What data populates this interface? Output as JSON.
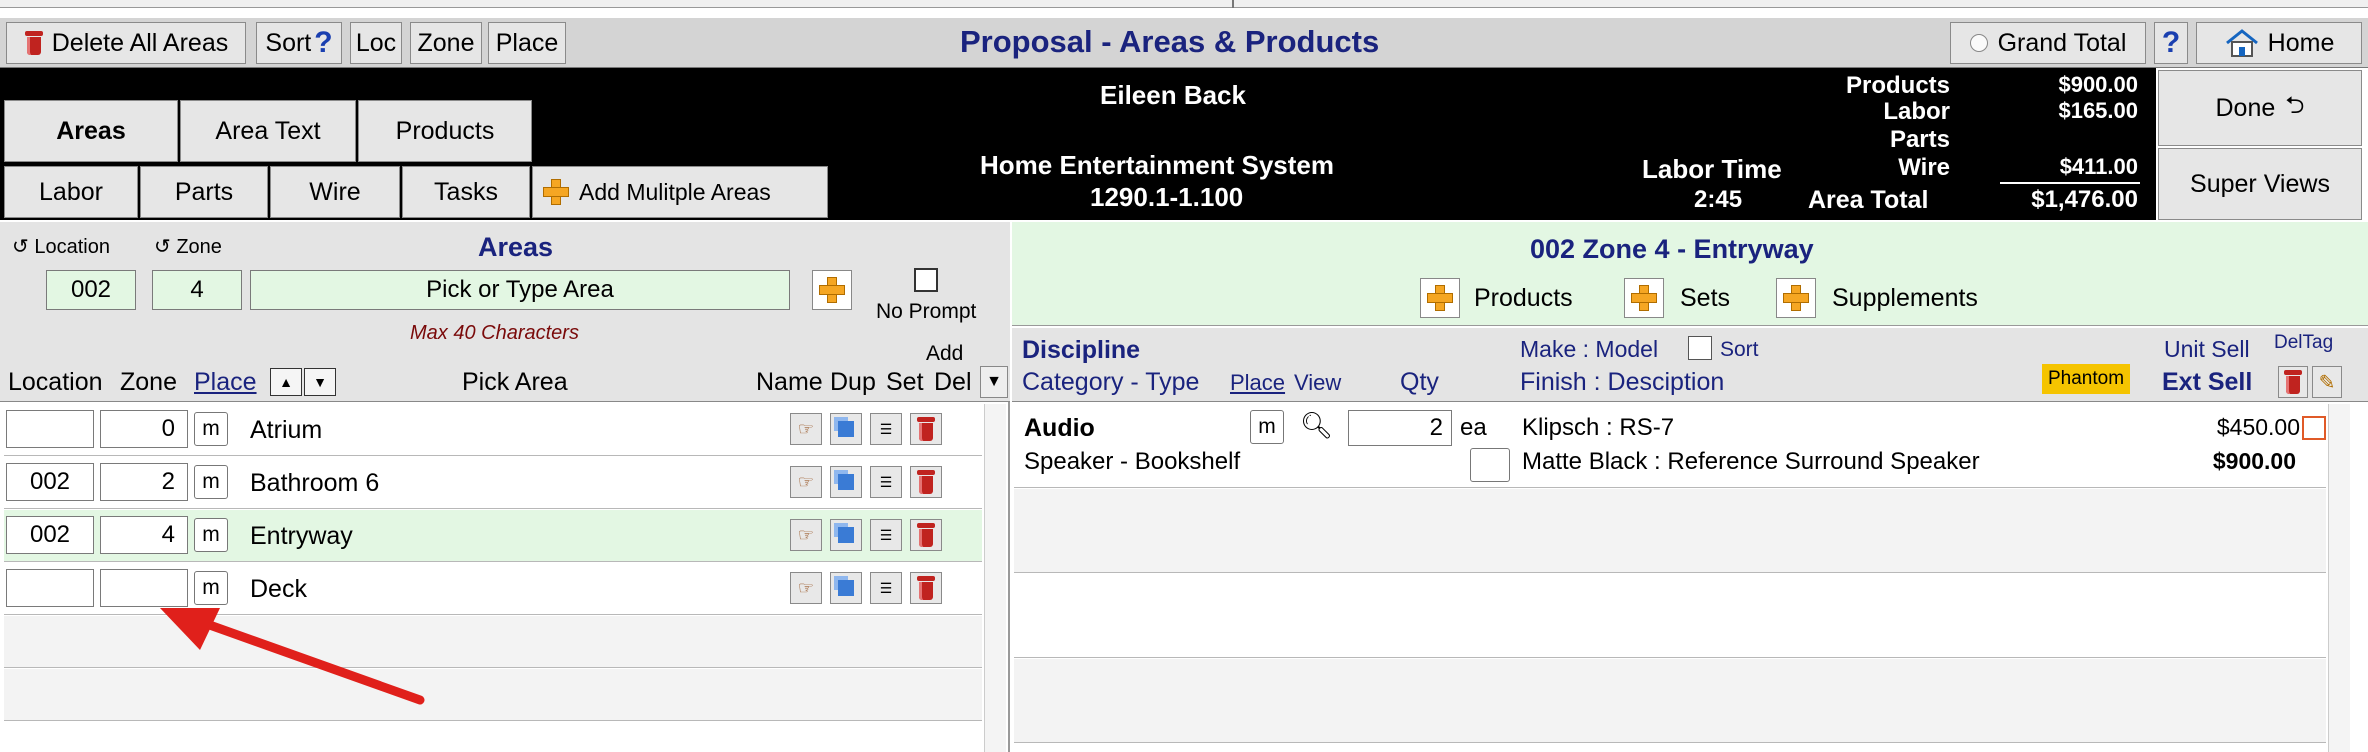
{
  "toolbar": {
    "delete_all": "Delete All Areas",
    "sort": "Sort",
    "sort_help": "?",
    "loc": "Loc",
    "zone": "Zone",
    "place": "Place",
    "title": "Proposal - Areas & Products",
    "grand_total": "Grand Total",
    "help": "?",
    "home": "Home"
  },
  "header": {
    "client": "Eileen Back",
    "project": "Home Entertainment System",
    "project_number": "1290.1-1.100",
    "labor_time_label": "Labor Time",
    "labor_time": "2:45",
    "area_total_label": "Area Total",
    "area_total": "$1,476.00",
    "totals": [
      {
        "label": "Products",
        "value": "$900.00"
      },
      {
        "label": "Labor",
        "value": "$165.00"
      },
      {
        "label": "Parts",
        "value": ""
      },
      {
        "label": "Wire",
        "value": "$411.00"
      }
    ],
    "done": "Done",
    "super_views": "Super Views"
  },
  "tabs": {
    "row1": [
      "Areas",
      "Area Text",
      "Products"
    ],
    "row2": [
      "Labor",
      "Parts",
      "Wire",
      "Tasks"
    ],
    "add_multiple": "Add Mulitple Areas"
  },
  "areas_panel": {
    "location_label": "Location",
    "zone_label": "Zone",
    "title": "Areas",
    "location_value": "002",
    "zone_value": "4",
    "area_placeholder": "Pick or Type Area",
    "no_prompt": "No Prompt",
    "max_chars": "Max 40 Characters",
    "col_location": "Location",
    "col_zone": "Zone",
    "col_place": "Place",
    "col_pick_area": "Pick Area",
    "col_name": "Name",
    "col_dup": "Dup",
    "col_add": "Add",
    "col_set": "Set",
    "col_del": "Del",
    "rows": [
      {
        "location": "",
        "zone": "0",
        "place": "m",
        "name": "Atrium"
      },
      {
        "location": "002",
        "zone": "2",
        "place": "m",
        "name": "Bathroom 6"
      },
      {
        "location": "002",
        "zone": "4",
        "place": "m",
        "name": "Entryway"
      },
      {
        "location": "",
        "zone": "",
        "place": "m",
        "name": "Deck"
      }
    ]
  },
  "products_panel": {
    "zone_title": "002 Zone 4 - Entryway",
    "add_products": "Products",
    "add_sets": "Sets",
    "add_supplements": "Supplements",
    "col_discipline": "Discipline",
    "col_category": "Category - Type",
    "col_place": "Place",
    "col_view": "View",
    "col_qty": "Qty",
    "col_make_model": "Make : Model",
    "col_sort": "Sort",
    "col_finish": "Finish : Desciption",
    "phantom": "Phantom",
    "col_unit_sell": "Unit Sell",
    "col_ext_sell": "Ext Sell",
    "col_del": "Del",
    "col_tag": "Tag",
    "items": [
      {
        "discipline": "Audio",
        "category": "Speaker - Bookshelf",
        "place": "m",
        "qty": "2",
        "unit": "ea",
        "make_model": "Klipsch : RS-7",
        "finish": "Matte Black : Reference Surround Speaker",
        "unit_sell": "$450.00",
        "ext_sell": "$900.00"
      }
    ]
  },
  "colors": {
    "header_bg": "#000000",
    "title_text": "#1a237e",
    "highlight_row": "#e3f7e3",
    "phantom_bg": "#f5c400",
    "arrow": "#e0201b"
  }
}
